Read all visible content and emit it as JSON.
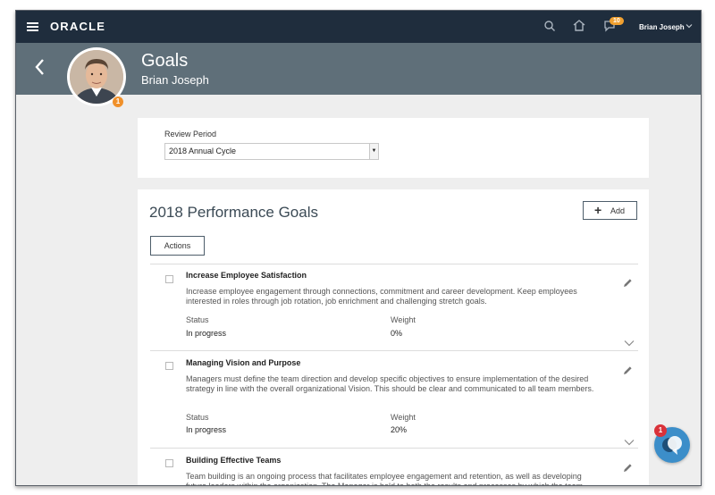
{
  "topbar": {
    "logo": "ORACLE",
    "notification_count": "10",
    "user_name": "Brian Joseph",
    "icons": [
      "menu-icon",
      "search-icon",
      "home-icon",
      "notifications-icon",
      "chevron-down-icon"
    ]
  },
  "header": {
    "title": "Goals",
    "subtitle": "Brian Joseph",
    "avatar_badge": "1"
  },
  "review": {
    "label": "Review Period",
    "selected": "2018 Annual Cycle"
  },
  "goals_section": {
    "title": "2018 Performance Goals",
    "add_label": "Add",
    "actions_label": "Actions",
    "status_label": "Status",
    "weight_label": "Weight",
    "items": [
      {
        "title": "Increase Employee Satisfaction",
        "description": "Increase employee engagement through connections, commitment and career development. Keep employees interested in roles through job rotation, job enrichment and challenging stretch goals.",
        "status": "In progress",
        "weight": "0%"
      },
      {
        "title": "Managing Vision and Purpose",
        "description": "Managers must define the team direction and develop specific objectives to ensure implementation of the desired strategy in line with the overall organizational Vision. This should be clear and communicated to all team members.",
        "status": "In progress",
        "weight": "20%"
      },
      {
        "title": "Building Effective Teams",
        "description": "Team building is an ongoing process that facilitates employee engagement and retention, as well as developing future leaders within the organization. The Manager is held to both the results and processes by which the team achieves",
        "status": "",
        "weight": ""
      }
    ]
  },
  "chat": {
    "badge": "1"
  },
  "colors": {
    "topbar": "#1f2d3d",
    "header": "#5f6f79",
    "notification_badge": "#f0a030",
    "chat_button": "#3c8ec9",
    "chat_badge": "#d9323a"
  }
}
